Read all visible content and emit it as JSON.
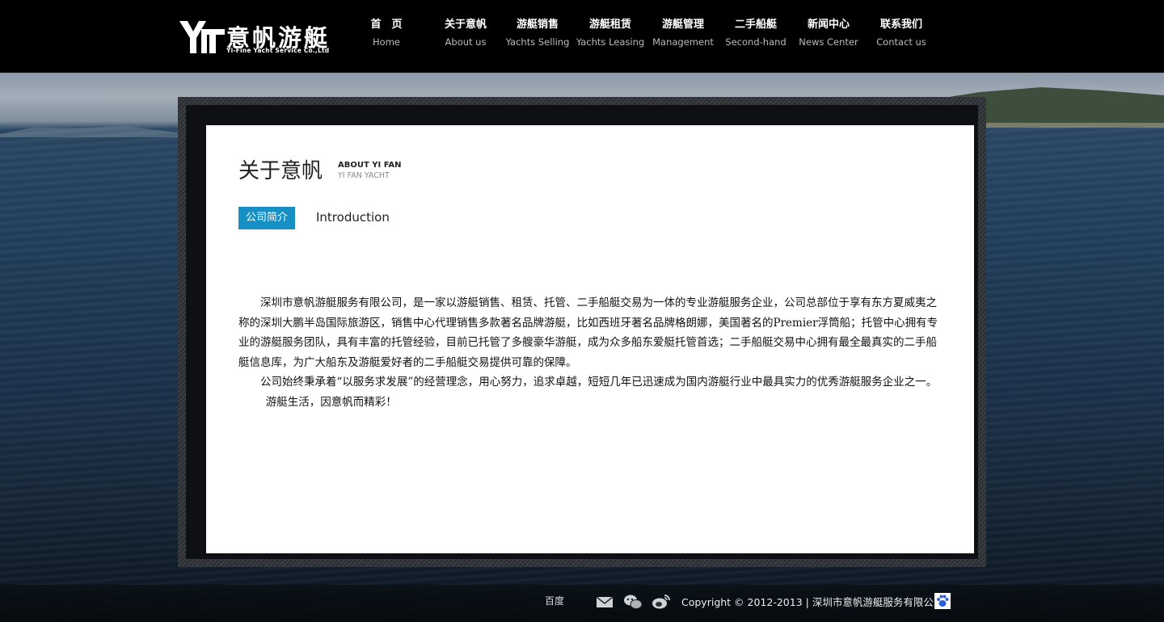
{
  "brand": {
    "name_cn": "意帆游艇",
    "name_en": "Yi-Fine Yacht Service Co.,Ltd"
  },
  "nav": [
    {
      "zh": "首　页",
      "en": "Home"
    },
    {
      "zh": "关于意帆",
      "en": "About us"
    },
    {
      "zh": "游艇销售",
      "en": "Yachts Selling"
    },
    {
      "zh": "游艇租赁",
      "en": "Yachts Leasing"
    },
    {
      "zh": "游艇管理",
      "en": "Management"
    },
    {
      "zh": "二手船艇",
      "en": "Second-hand"
    },
    {
      "zh": "新闻中心",
      "en": "News Center"
    },
    {
      "zh": "联系我们",
      "en": "Contact us"
    }
  ],
  "page": {
    "title_zh": "关于意帆",
    "title_en_line1": "ABOUT YI FAN",
    "title_en_line2": "YI FAN YACHT",
    "tab_label": "公司简介",
    "tab_en": "Introduction",
    "paragraphs": [
      "深圳市意帆游艇服务有限公司，是一家以游艇销售、租赁、托管、二手船艇交易为一体的专业游艇服务企业，公司总部位于享有东方夏威夷之称的深圳大鹏半岛国际旅游区，销售中心代理销售多款著名品牌游艇，比如西班牙著名品牌格朗娜，美国著名的Premier浮筒船；托管中心拥有专业的游艇服务团队，具有丰富的托管经验，目前已托管了多艘豪华游艇，成为众多船东爱艇托管首选；二手船艇交易中心拥有最全最真实的二手船艇信息库，为广大船东及游艇爱好者的二手船艇交易提供可靠的保障。",
      "公司始终秉承着“以服务求发展”的经营理念，用心努力，追求卓越，短短几年已迅速成为国内游艇行业中最具实力的优秀游艇服务企业之一。"
    ],
    "slogan": "游艇生活，因意帆而精彩！"
  },
  "footer": {
    "baidu": "百度",
    "copyright": "Copyright © 2012-2013 | 深圳市意帆游艇服务有限公司",
    "icons": [
      "mail-icon",
      "wechat-icon",
      "weibo-icon",
      "baidu-paw-icon"
    ]
  }
}
